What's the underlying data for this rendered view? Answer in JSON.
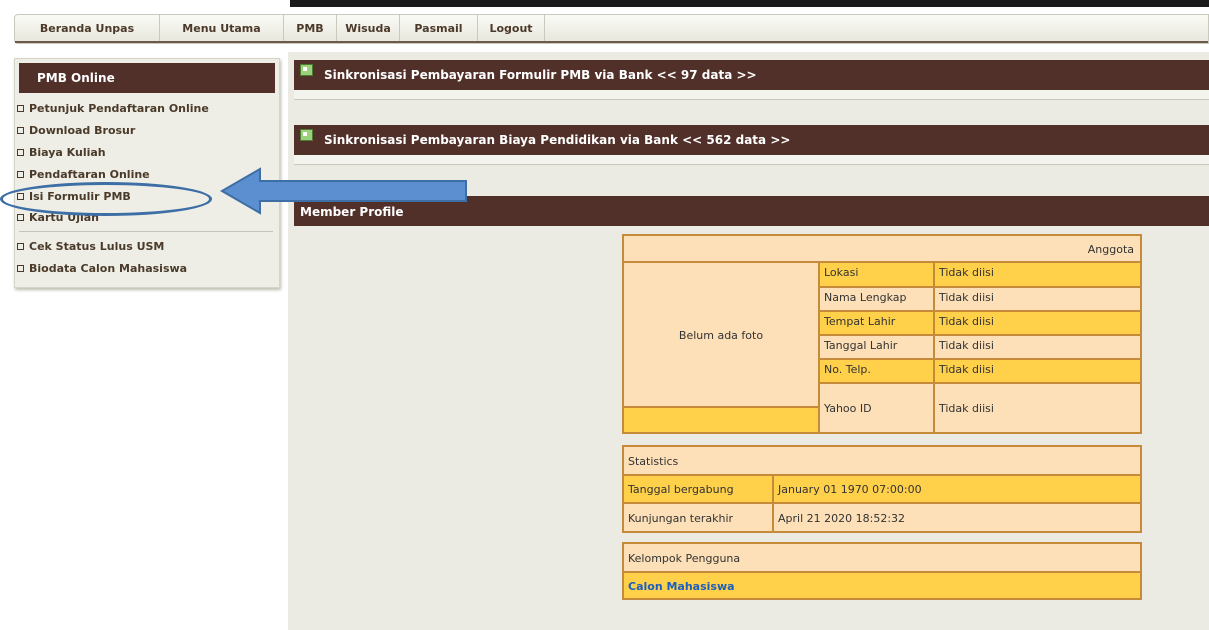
{
  "nav": {
    "items": [
      "Beranda Unpas",
      "Menu Utama",
      "PMB",
      "Wisuda",
      "Pasmail",
      "Logout"
    ]
  },
  "sidebar": {
    "title": "PMB Online",
    "links": [
      "Petunjuk Pendaftaran Online",
      "Download Brosur",
      "Biaya Kuliah",
      "Pendaftaran Online",
      "Isi Formulir PMB",
      "Kartu Ujian",
      "Cek Status Lulus USM",
      "Biodata Calon Mahasiswa"
    ]
  },
  "main": {
    "bar1": "Sinkronisasi Pembayaran Formulir PMB via Bank << 97 data >>",
    "bar2": "Sinkronisasi Pembayaran Biaya Pendidikan via Bank << 562 data >>",
    "bar3": "Member Profile"
  },
  "profile": {
    "header": "Anggota",
    "photo_text": "Belum ada foto",
    "rows": [
      {
        "label": "Lokasi",
        "value": "Tidak diisi"
      },
      {
        "label": "Nama Lengkap",
        "value": "Tidak diisi"
      },
      {
        "label": "Tempat Lahir",
        "value": "Tidak diisi"
      },
      {
        "label": "Tanggal Lahir",
        "value": "Tidak diisi"
      },
      {
        "label": "No. Telp.",
        "value": "Tidak diisi"
      },
      {
        "label": "Yahoo ID",
        "value": "Tidak diisi"
      }
    ]
  },
  "statistics": {
    "title": "Statistics",
    "rows": [
      {
        "label": "Tanggal bergabung",
        "value": "January 01 1970 07:00:00"
      },
      {
        "label": "Kunjungan terakhir",
        "value": "April 21 2020 18:52:32"
      }
    ]
  },
  "group": {
    "title": "Kelompok Pengguna",
    "value": "Calon Mahasiswa"
  },
  "colors": {
    "dark_brown": "#52302a",
    "yellow": "#ffd04a",
    "peach": "#fde0b8",
    "annotation_blue": "#3d6ea5"
  }
}
